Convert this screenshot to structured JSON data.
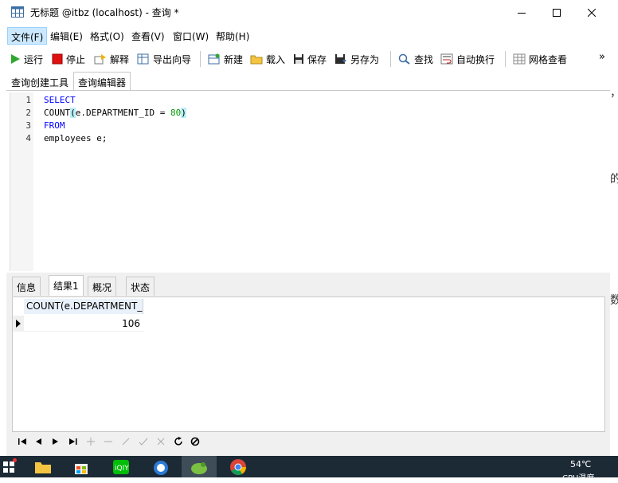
{
  "window": {
    "title": "无标题 @itbz (localhost) - 查询 *"
  },
  "menu": {
    "items": [
      "文件(F)",
      "编辑(E)",
      "格式(O)",
      "查看(V)",
      "窗口(W)",
      "帮助(H)"
    ]
  },
  "toolbar": {
    "run": "运行",
    "stop": "停止",
    "explain": "解释",
    "export": "导出向导",
    "new": "新建",
    "load": "载入",
    "save": "保存",
    "save_as": "另存为",
    "find": "查找",
    "wrap": "自动换行",
    "grid_view": "网格查看",
    "overflow": "»"
  },
  "tabs": {
    "builder": "查询创建工具",
    "editor": "查询编辑器"
  },
  "editor": {
    "line_numbers": [
      "1",
      "2",
      "3",
      "4"
    ],
    "line1": "SELECT",
    "line2_prefix": "COUNT",
    "line2_open": "(",
    "line2_mid": "e.DEPARTMENT_ID = ",
    "line2_num": "80",
    "line2_close": ")",
    "line3": "FROM",
    "line4": "employees e;"
  },
  "result_tabs": [
    "信息",
    "结果1",
    "概况",
    "状态"
  ],
  "result": {
    "column": "COUNT(e.DEPARTMENT_I",
    "value": "106"
  },
  "side_fragments": [
    "，",
    "的",
    "数"
  ],
  "taskbar": {
    "temperature": "54℃",
    "cpu_label": "CPU温度"
  }
}
